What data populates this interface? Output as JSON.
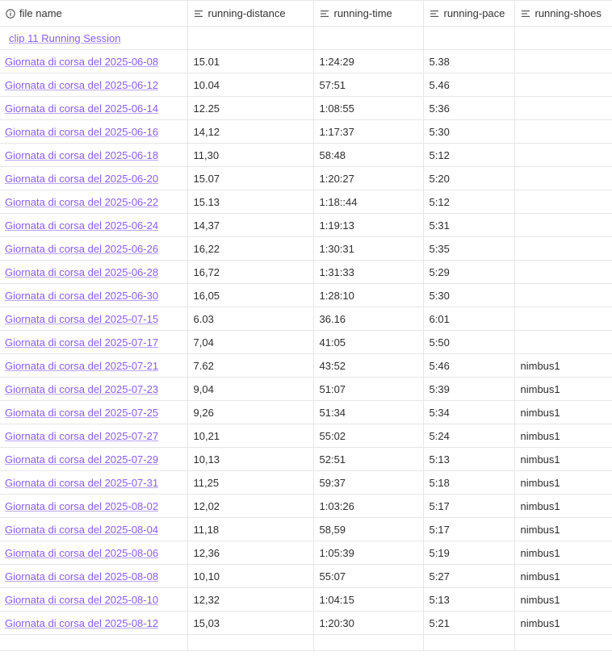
{
  "columns": [
    {
      "label": "file name",
      "icon": "info-icon"
    },
    {
      "label": "running-distance",
      "icon": "text-lines-icon"
    },
    {
      "label": "running-time",
      "icon": "text-lines-icon"
    },
    {
      "label": "running-pace",
      "icon": "text-lines-icon"
    },
    {
      "label": "running-shoes",
      "icon": "text-lines-icon"
    }
  ],
  "rows": [
    {
      "file": "clip 11 Running Session",
      "distance": "",
      "time": "",
      "pace": "",
      "shoes": ""
    },
    {
      "file": "Giornata di corsa del 2025-06-08",
      "distance": "15.01",
      "time": "1:24:29",
      "pace": "5.38",
      "shoes": ""
    },
    {
      "file": "Giornata di corsa del 2025-06-12",
      "distance": "10.04",
      "time": "57:51",
      "pace": "5.46",
      "shoes": ""
    },
    {
      "file": "Giornata di corsa del 2025-06-14",
      "distance": "12.25",
      "time": "1:08:55",
      "pace": "5:36",
      "shoes": ""
    },
    {
      "file": "Giornata di corsa del 2025-06-16",
      "distance": "14,12",
      "time": "1:17:37",
      "pace": "5:30",
      "shoes": ""
    },
    {
      "file": "Giornata di corsa del 2025-06-18",
      "distance": "11,30",
      "time": "58:48",
      "pace": "5:12",
      "shoes": ""
    },
    {
      "file": "Giornata di corsa del 2025-06-20",
      "distance": "15.07",
      "time": "1:20:27",
      "pace": "5:20",
      "shoes": ""
    },
    {
      "file": "Giornata di corsa del 2025-06-22",
      "distance": "15.13",
      "time": "1:18::44",
      "pace": "5:12",
      "shoes": ""
    },
    {
      "file": "Giornata di corsa del 2025-06-24",
      "distance": "14,37",
      "time": "1:19:13",
      "pace": "5:31",
      "shoes": ""
    },
    {
      "file": "Giornata di corsa del 2025-06-26",
      "distance": "16,22",
      "time": "1:30:31",
      "pace": "5:35",
      "shoes": ""
    },
    {
      "file": "Giornata di corsa del 2025-06-28",
      "distance": "16,72",
      "time": "1:31:33",
      "pace": "5:29",
      "shoes": ""
    },
    {
      "file": "Giornata di corsa del 2025-06-30",
      "distance": "16,05",
      "time": "1:28:10",
      "pace": "5:30",
      "shoes": ""
    },
    {
      "file": "Giornata di corsa del 2025-07-15",
      "distance": "6.03",
      "time": "36.16",
      "pace": "6:01",
      "shoes": ""
    },
    {
      "file": "Giornata di corsa del 2025-07-17",
      "distance": "7,04",
      "time": "41:05",
      "pace": "5:50",
      "shoes": ""
    },
    {
      "file": "Giornata di corsa del 2025-07-21",
      "distance": "7.62",
      "time": "43:52",
      "pace": "5:46",
      "shoes": "nimbus1"
    },
    {
      "file": "Giornata di corsa del 2025-07-23",
      "distance": "9,04",
      "time": "51:07",
      "pace": "5:39",
      "shoes": "nimbus1"
    },
    {
      "file": "Giornata di corsa del 2025-07-25",
      "distance": "9,26",
      "time": "51:34",
      "pace": "5:34",
      "shoes": "nimbus1"
    },
    {
      "file": "Giornata di corsa del 2025-07-27",
      "distance": "10,21",
      "time": "55:02",
      "pace": "5:24",
      "shoes": "nimbus1"
    },
    {
      "file": "Giornata di corsa del 2025-07-29",
      "distance": "10,13",
      "time": "52:51",
      "pace": "5:13",
      "shoes": "nimbus1"
    },
    {
      "file": "Giornata di corsa del 2025-07-31",
      "distance": "11,25",
      "time": "59:37",
      "pace": "5:18",
      "shoes": "nimbus1"
    },
    {
      "file": "Giornata di corsa del 2025-08-02",
      "distance": "12,02",
      "time": "1:03:26",
      "pace": "5:17",
      "shoes": "nimbus1"
    },
    {
      "file": "Giornata di corsa del 2025-08-04",
      "distance": "11,18",
      "time": "58,59",
      "pace": "5:17",
      "shoes": "nimbus1"
    },
    {
      "file": "Giornata di corsa del 2025-08-06",
      "distance": "12,36",
      "time": "1:05:39",
      "pace": "5:19",
      "shoes": "nimbus1"
    },
    {
      "file": "Giornata di corsa del 2025-08-08",
      "distance": "10,10",
      "time": "55:07",
      "pace": "5:27",
      "shoes": "nimbus1"
    },
    {
      "file": "Giornata di corsa del 2025-08-10",
      "distance": "12,32",
      "time": "1:04:15",
      "pace": "5:13",
      "shoes": "nimbus1"
    },
    {
      "file": "Giornata di corsa del 2025-08-12",
      "distance": "15,03",
      "time": "1:20:30",
      "pace": "5:21",
      "shoes": "nimbus1"
    }
  ],
  "colors": {
    "link": "#8a5cf5",
    "grid": "#e6e6e6",
    "text": "#2e2e2e"
  }
}
